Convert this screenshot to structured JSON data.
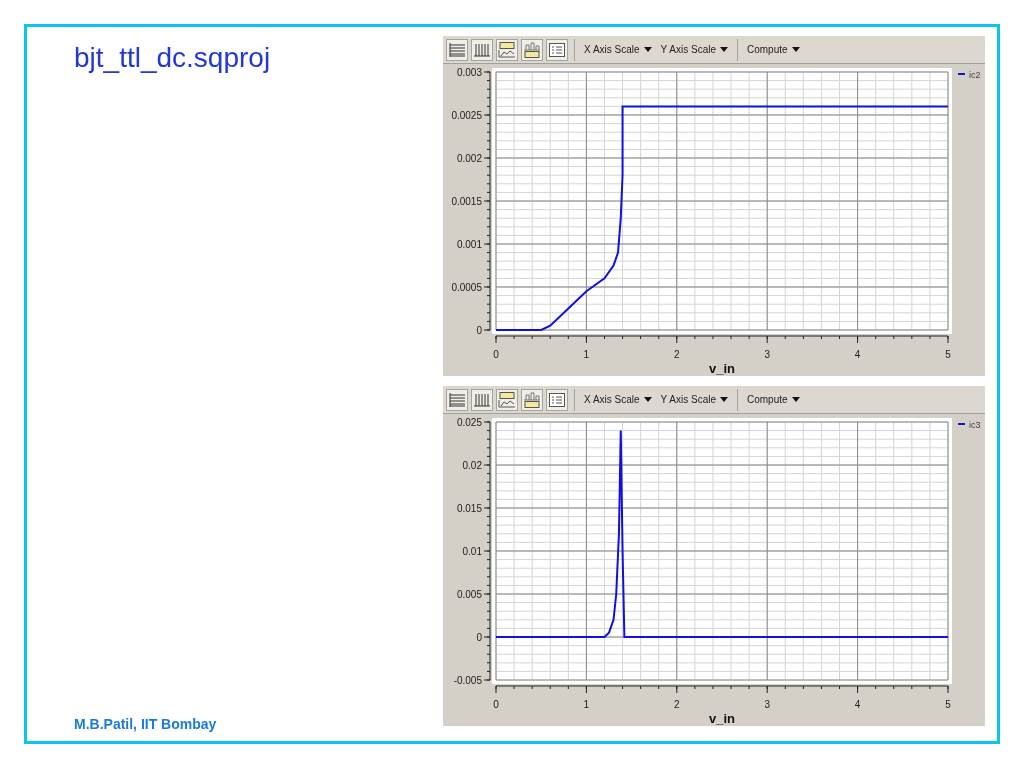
{
  "slide": {
    "title": "bjt_ttl_dc.sqproj",
    "footer": "M.B.Patil, IIT Bombay"
  },
  "plots": [
    {
      "toolbar": {
        "menus": [
          "X Axis Scale",
          "Y Axis Scale",
          "Compute"
        ]
      },
      "chart_data": {
        "type": "line",
        "xlabel": "v_in",
        "x": [
          0,
          0.45,
          0.5,
          0.6,
          0.8,
          1.0,
          1.2,
          1.3,
          1.35,
          1.38,
          1.4,
          1.4,
          5
        ],
        "series": [
          {
            "name": "ic2",
            "color": "#1010e0",
            "values": [
              0,
              0,
              0,
              5e-05,
              0.00025,
              0.00045,
              0.0006,
              0.00075,
              0.0009,
              0.0013,
              0.0018,
              0.0026,
              0.0026
            ]
          }
        ],
        "grid": true,
        "xlim": [
          0,
          5
        ],
        "ylim": [
          0,
          0.003
        ],
        "xticks": [
          0,
          1,
          2,
          3,
          4,
          5
        ],
        "yticks": [
          {
            "value": 0,
            "label": "0"
          },
          {
            "value": 0.0005,
            "label": "0.0005"
          },
          {
            "value": 0.001,
            "label": "0.001"
          },
          {
            "value": 0.0015,
            "label": "0.0015"
          },
          {
            "value": 0.002,
            "label": "0.002"
          },
          {
            "value": 0.0025,
            "label": "0.0025"
          },
          {
            "value": 0.003,
            "label": "0.003"
          }
        ]
      }
    },
    {
      "toolbar": {
        "menus": [
          "X Axis Scale",
          "Y Axis Scale",
          "Compute"
        ]
      },
      "chart_data": {
        "type": "line",
        "xlabel": "v_in",
        "x": [
          0,
          1.2,
          1.25,
          1.3,
          1.33,
          1.36,
          1.38,
          1.4,
          1.42,
          5
        ],
        "series": [
          {
            "name": "ic3",
            "color": "#1010e0",
            "values": [
              0,
              0,
              0.0005,
              0.002,
              0.005,
              0.012,
              0.024,
              0.01,
              0,
              0
            ]
          }
        ],
        "grid": true,
        "xlim": [
          0,
          5
        ],
        "ylim": [
          -0.005,
          0.025
        ],
        "xticks": [
          0,
          1,
          2,
          3,
          4,
          5
        ],
        "yticks": [
          {
            "value": -0.005,
            "label": "-0.005"
          },
          {
            "value": 0,
            "label": "0"
          },
          {
            "value": 0.005,
            "label": "0.005"
          },
          {
            "value": 0.01,
            "label": "0.01"
          },
          {
            "value": 0.015,
            "label": "0.015"
          },
          {
            "value": 0.02,
            "label": "0.02"
          },
          {
            "value": 0.025,
            "label": "0.025"
          }
        ]
      }
    }
  ]
}
